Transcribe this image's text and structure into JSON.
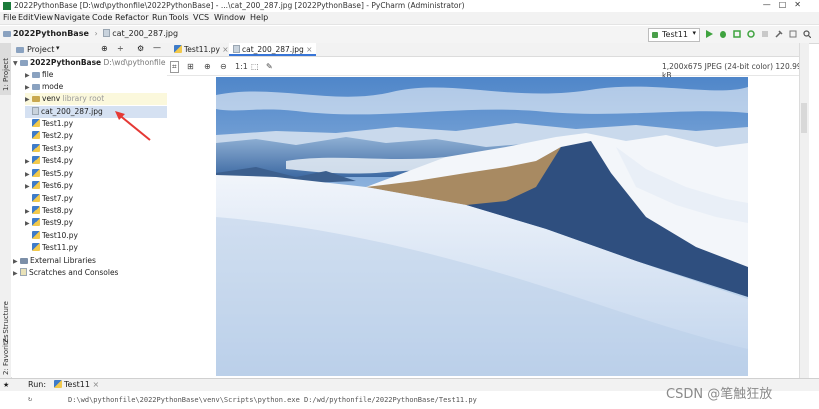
{
  "window": {
    "title": "2022PythonBase [D:\\wd\\pythonfile\\2022PythonBase] - ...\\cat_200_287.jpg [2022PythonBase] - PyCharm (Administrator)",
    "controls": [
      "—",
      "□",
      "✕"
    ]
  },
  "menu": [
    "File",
    "Edit",
    "View",
    "Navigate",
    "Code",
    "Refactor",
    "Run",
    "Tools",
    "VCS",
    "Window",
    "Help"
  ],
  "breadcrumb": {
    "project": "2022PythonBase",
    "file": "cat_200_287.jpg"
  },
  "run_config": {
    "name": "Test11"
  },
  "left_strip": {
    "project": "1: Project",
    "structure": "Z: Structure",
    "favorites": "2: Favorites"
  },
  "project_panel": {
    "title": "Project",
    "root": {
      "name": "2022PythonBase",
      "path": "D:\\wd\\pythonfile"
    },
    "items": [
      {
        "label": "file",
        "type": "folder",
        "expand": true
      },
      {
        "label": "mode",
        "type": "folder",
        "expand": true
      },
      {
        "label": "venv",
        "suffix": "library root",
        "type": "folder",
        "expand": true
      },
      {
        "label": "cat_200_287.jpg",
        "type": "image",
        "expand": false,
        "selected": true
      },
      {
        "label": "Test1.py",
        "type": "py",
        "expand": false
      },
      {
        "label": "Test2.py",
        "type": "py",
        "expand": false
      },
      {
        "label": "Test3.py",
        "type": "py",
        "expand": false
      },
      {
        "label": "Test4.py",
        "type": "py",
        "expand": true
      },
      {
        "label": "Test5.py",
        "type": "py",
        "expand": true
      },
      {
        "label": "Test6.py",
        "type": "py",
        "expand": true
      },
      {
        "label": "Test7.py",
        "type": "py",
        "expand": false
      },
      {
        "label": "Test8.py",
        "type": "py",
        "expand": true
      },
      {
        "label": "Test9.py",
        "type": "py",
        "expand": true
      },
      {
        "label": "Test10.py",
        "type": "py",
        "expand": false
      },
      {
        "label": "Test11.py",
        "type": "py",
        "expand": false
      }
    ],
    "external": "External Libraries",
    "scratches": "Scratches and Consoles"
  },
  "editor_tabs": [
    {
      "label": "Test11.py",
      "active": false
    },
    {
      "label": "cat_200_287.jpg",
      "active": true
    }
  ],
  "image_viewer": {
    "zoom_label": "1:1",
    "info": "1,200x675 JPEG (24-bit color) 120.99 kB"
  },
  "bottom": {
    "run_label": "Run:",
    "run_tab": "Test11",
    "console_line": "D:\\wd\\pythonfile\\2022PythonBase\\venv\\Scripts\\python.exe D:/wd/pythonfile/2022PythonBase/Test11.py"
  },
  "watermark": "CSDN @笔触狂放",
  "colors": {
    "selection": "#d5e1f2",
    "accent": "#3875d7",
    "annotation_arrow": "#e53935"
  }
}
